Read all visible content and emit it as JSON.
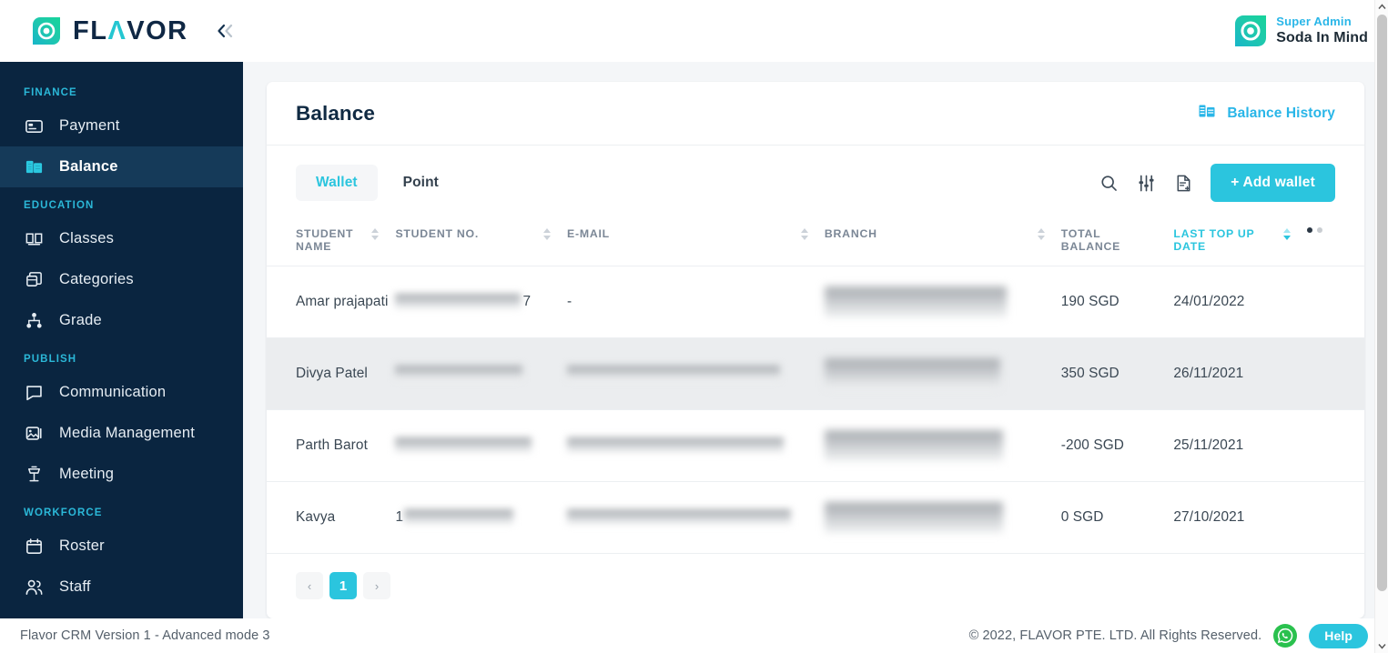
{
  "brand": {
    "word_1": "FL",
    "word_accent": "Λ",
    "word_2": "VOR",
    "full": "FLAVOR"
  },
  "user": {
    "role": "Super Admin",
    "name": "Soda In Mind"
  },
  "sidebar": {
    "groups": [
      {
        "label": "FINANCE",
        "items": [
          {
            "label": "Payment",
            "icon": "credit-card-icon",
            "active": false
          },
          {
            "label": "Balance",
            "icon": "balance-sheet-icon",
            "active": true
          }
        ]
      },
      {
        "label": "EDUCATION",
        "items": [
          {
            "label": "Classes",
            "icon": "open-book-icon",
            "active": false
          },
          {
            "label": "Categories",
            "icon": "box-stack-icon",
            "active": false
          },
          {
            "label": "Grade",
            "icon": "hierarchy-icon",
            "active": false
          }
        ]
      },
      {
        "label": "PUBLISH",
        "items": [
          {
            "label": "Communication",
            "icon": "chat-bubble-icon",
            "active": false
          },
          {
            "label": "Media Management",
            "icon": "image-stack-icon",
            "active": false
          },
          {
            "label": "Meeting",
            "icon": "podium-icon",
            "active": false
          }
        ]
      },
      {
        "label": "WORKFORCE",
        "items": [
          {
            "label": "Roster",
            "icon": "calendar-icon",
            "active": false
          },
          {
            "label": "Staff",
            "icon": "people-icon",
            "active": false
          }
        ]
      }
    ]
  },
  "card": {
    "title": "Balance",
    "history_link": "Balance History",
    "tabs": [
      {
        "label": "Wallet",
        "active": true
      },
      {
        "label": "Point",
        "active": false
      }
    ],
    "add_button": "+ Add wallet"
  },
  "table": {
    "columns": [
      {
        "label": "STUDENT NAME",
        "sortable": true,
        "sorted": false
      },
      {
        "label": "STUDENT NO.",
        "sortable": true,
        "sorted": false
      },
      {
        "label": "E-MAIL",
        "sortable": true,
        "sorted": false
      },
      {
        "label": "BRANCH",
        "sortable": true,
        "sorted": false
      },
      {
        "label": "TOTAL BALANCE",
        "sortable": false,
        "sorted": false
      },
      {
        "label": "LAST TOP UP DATE",
        "sortable": true,
        "sorted": true
      },
      {
        "label": "",
        "sortable": false,
        "sorted": false
      }
    ],
    "rows": [
      {
        "student_name": "Amar prajapati",
        "student_no": "•••••••••••7",
        "email": "-",
        "branch": "",
        "total_balance": "190 SGD",
        "last_top_up_date": "24/01/2022",
        "alt": false
      },
      {
        "student_name": "Divya Patel",
        "student_no": "",
        "email": "",
        "branch": "",
        "total_balance": "350 SGD",
        "last_top_up_date": "26/11/2021",
        "alt": true
      },
      {
        "student_name": "Parth Barot",
        "student_no": "",
        "email": "",
        "branch": "",
        "total_balance": "-200 SGD",
        "last_top_up_date": "25/11/2021",
        "alt": false
      },
      {
        "student_name": "Kavya",
        "student_no": "1",
        "email": "",
        "branch": "",
        "total_balance": "0 SGD",
        "last_top_up_date": "27/10/2021",
        "alt": false
      }
    ]
  },
  "pagination": {
    "prev": "‹",
    "current": "1",
    "next": "›"
  },
  "footer": {
    "version": "Flavor CRM Version 1 - Advanced mode 3",
    "copyright": "© 2022, FLAVOR PTE. LTD. All Rights Reserved.",
    "help_label": "Help"
  },
  "colors": {
    "accent": "#2bc5de",
    "link": "#29b6e8",
    "sidebar_bg": "#0a2540",
    "sidebar_active": "#153a59",
    "title": "#102a43",
    "whatsapp": "#2ac14e"
  }
}
